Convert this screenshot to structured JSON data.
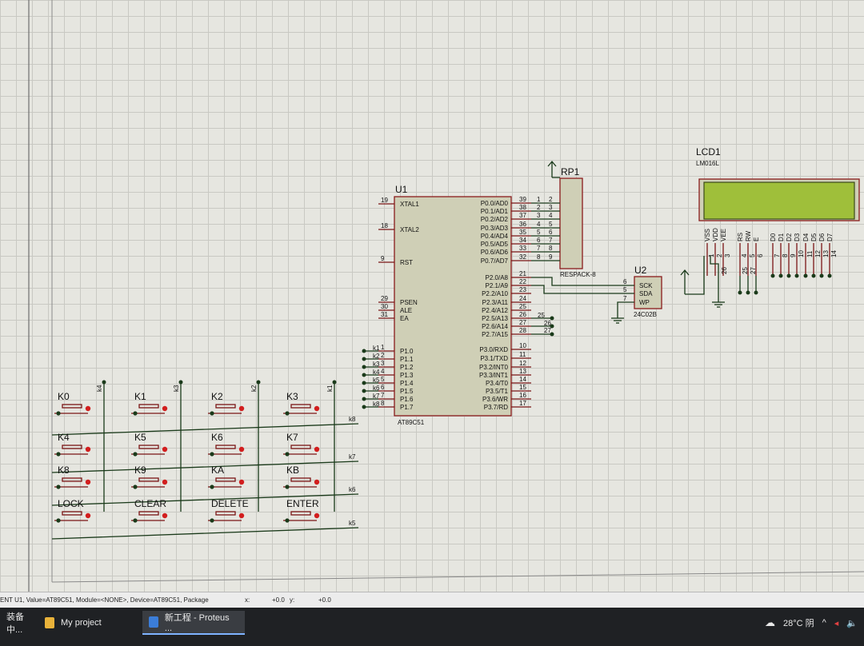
{
  "u1": {
    "ref": "U1",
    "part": "AT89C51",
    "left_pins": [
      {
        "num": "19",
        "name": "XTAL1"
      },
      {
        "num": "18",
        "name": "XTAL2"
      },
      {
        "num": "9",
        "name": "RST"
      },
      {
        "num": "29",
        "name": "PSEN"
      },
      {
        "num": "30",
        "name": "ALE"
      },
      {
        "num": "31",
        "name": "EA"
      },
      {
        "num": "1",
        "name": "P1.0"
      },
      {
        "num": "2",
        "name": "P1.1"
      },
      {
        "num": "3",
        "name": "P1.2"
      },
      {
        "num": "4",
        "name": "P1.3"
      },
      {
        "num": "5",
        "name": "P1.4"
      },
      {
        "num": "6",
        "name": "P1.5"
      },
      {
        "num": "7",
        "name": "P1.6"
      },
      {
        "num": "8",
        "name": "P1.7"
      }
    ],
    "right_pins": [
      {
        "num": "39",
        "name": "P0.0/AD0"
      },
      {
        "num": "38",
        "name": "P0.1/AD1"
      },
      {
        "num": "37",
        "name": "P0.2/AD2"
      },
      {
        "num": "36",
        "name": "P0.3/AD3"
      },
      {
        "num": "35",
        "name": "P0.4/AD4"
      },
      {
        "num": "34",
        "name": "P0.5/AD5"
      },
      {
        "num": "33",
        "name": "P0.6/AD6"
      },
      {
        "num": "32",
        "name": "P0.7/AD7"
      },
      {
        "num": "21",
        "name": "P2.0/A8"
      },
      {
        "num": "22",
        "name": "P2.1/A9"
      },
      {
        "num": "23",
        "name": "P2.2/A10"
      },
      {
        "num": "24",
        "name": "P2.3/A11"
      },
      {
        "num": "25",
        "name": "P2.4/A12"
      },
      {
        "num": "26",
        "name": "P2.5/A13"
      },
      {
        "num": "27",
        "name": "P2.6/A14"
      },
      {
        "num": "28",
        "name": "P2.7/A15"
      },
      {
        "num": "10",
        "name": "P3.0/RXD"
      },
      {
        "num": "11",
        "name": "P3.1/TXD"
      },
      {
        "num": "12",
        "name": "P3.2/INT0"
      },
      {
        "num": "13",
        "name": "P3.3/INT1"
      },
      {
        "num": "14",
        "name": "P3.4/T0"
      },
      {
        "num": "15",
        "name": "P3.5/T1"
      },
      {
        "num": "16",
        "name": "P3.6/WR"
      },
      {
        "num": "17",
        "name": "P3.7/RD"
      }
    ]
  },
  "rp1": {
    "ref": "RP1",
    "part": "RESPACK-8",
    "pins_left": [
      "1",
      "2",
      "3",
      "4",
      "5",
      "6",
      "7",
      "8"
    ],
    "pins_right": [
      "2",
      "3",
      "4",
      "5",
      "6",
      "7",
      "8",
      "9"
    ]
  },
  "u2": {
    "ref": "U2",
    "part": "24C02B",
    "pins": [
      {
        "num": "6",
        "name": "SCK"
      },
      {
        "num": "5",
        "name": "SDA"
      },
      {
        "num": "7",
        "name": "WP"
      }
    ]
  },
  "lcd": {
    "ref": "LCD1",
    "part": "LM016L",
    "pin_names": [
      "VSS",
      "VDD",
      "VEE",
      "RS",
      "RW",
      "E",
      "D0",
      "D1",
      "D2",
      "D3",
      "D4",
      "D5",
      "D6",
      "D7"
    ],
    "pin_nums": [
      "1",
      "2",
      "3",
      "4",
      "5",
      "6",
      "7",
      "8",
      "9",
      "10",
      "11",
      "12",
      "13",
      "14"
    ],
    "wire_labels": [
      "26",
      "25",
      "27"
    ]
  },
  "net_labels": {
    "k_left": [
      "k1",
      "k2",
      "k3",
      "k4",
      "k5",
      "k6",
      "k7",
      "k8"
    ],
    "cols": [
      "k4",
      "k3",
      "k2",
      "k1"
    ],
    "rows": [
      "k8",
      "k7",
      "k6",
      "k5"
    ],
    "p2_small": [
      "25",
      "26",
      "27"
    ]
  },
  "keys": [
    [
      "K0",
      "K1",
      "K2",
      "K3"
    ],
    [
      "K4",
      "K5",
      "K6",
      "K7"
    ],
    [
      "K8",
      "K9",
      "KA",
      "KB"
    ],
    [
      "LOCK",
      "CLEAR",
      "DELETE",
      "ENTER"
    ]
  ],
  "status": {
    "info": "ENT U1, Value=AT89C51, Module=<NONE>, Device=AT89C51, Package",
    "x_label": "x:",
    "x_value": "+0.0",
    "y_label": "y:",
    "y_value": "+0.0"
  },
  "taskbar": {
    "item0": "装备中...",
    "item1": "My project",
    "item2": "新工程 - Proteus ...",
    "weather": "28°C 阴"
  },
  "colors": {
    "wire": "#1a3a1a",
    "component": "#8b1c1c",
    "lcd_screen": "#9fbf3a",
    "ic_fill": "#cfcfb6"
  }
}
